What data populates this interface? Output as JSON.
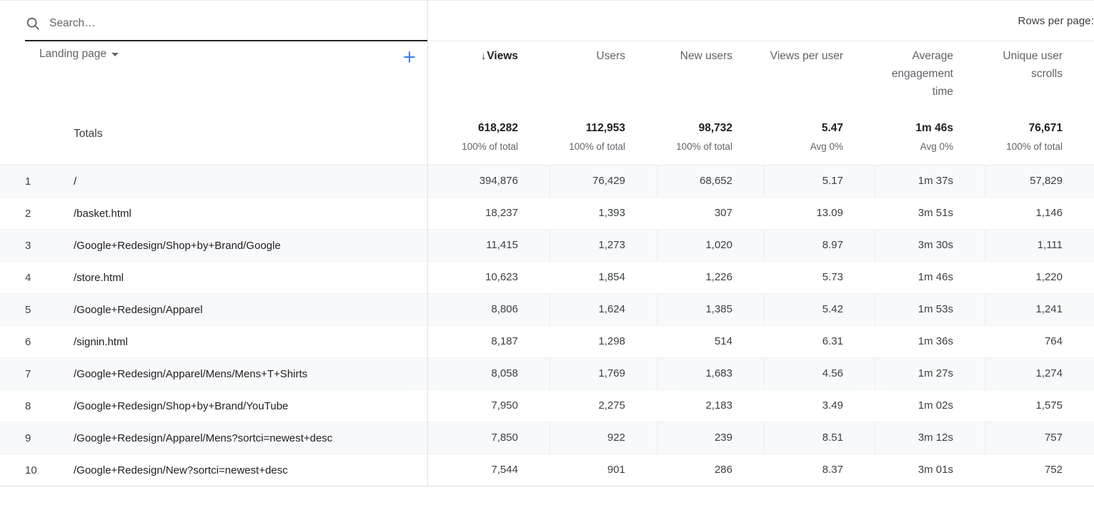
{
  "search": {
    "placeholder": "Search…",
    "value": "",
    "icon": "search-icon"
  },
  "rows_per_page_label": "Rows per page:",
  "dimension": {
    "label": "Landing page",
    "caret_icon": "chevron-down-icon",
    "add_icon": "plus-icon",
    "totals_label": "Totals"
  },
  "colors": {
    "accent_blue": "#4285f4",
    "text_primary": "#202124",
    "text_secondary": "#5f6368",
    "row_shade": "#f8f9fa"
  },
  "chart_data": {
    "type": "table",
    "title": "Landing page",
    "sort": {
      "column": "Views",
      "direction": "descending",
      "indicator": "↓"
    },
    "columns": [
      "Landing page",
      "Views",
      "Users",
      "New users",
      "Views per user",
      "Average engagement time",
      "Unique user scrolls"
    ],
    "totals": {
      "label": "Totals",
      "values": [
        "618,282",
        "112,953",
        "98,732",
        "5.47",
        "1m 46s",
        "76,671"
      ],
      "subvalues": [
        "100% of total",
        "100% of total",
        "100% of total",
        "Avg 0%",
        "Avg 0%",
        "100% of total"
      ]
    },
    "rows": [
      {
        "index": "1",
        "dimension": "/",
        "values": [
          "394,876",
          "76,429",
          "68,652",
          "5.17",
          "1m 37s",
          "57,829"
        ]
      },
      {
        "index": "2",
        "dimension": "/basket.html",
        "values": [
          "18,237",
          "1,393",
          "307",
          "13.09",
          "3m 51s",
          "1,146"
        ]
      },
      {
        "index": "3",
        "dimension": "/Google+Redesign/Shop+by+Brand/Google",
        "values": [
          "11,415",
          "1,273",
          "1,020",
          "8.97",
          "3m 30s",
          "1,111"
        ]
      },
      {
        "index": "4",
        "dimension": "/store.html",
        "values": [
          "10,623",
          "1,854",
          "1,226",
          "5.73",
          "1m 46s",
          "1,220"
        ]
      },
      {
        "index": "5",
        "dimension": "/Google+Redesign/Apparel",
        "values": [
          "8,806",
          "1,624",
          "1,385",
          "5.42",
          "1m 53s",
          "1,241"
        ]
      },
      {
        "index": "6",
        "dimension": "/signin.html",
        "values": [
          "8,187",
          "1,298",
          "514",
          "6.31",
          "1m 36s",
          "764"
        ]
      },
      {
        "index": "7",
        "dimension": "/Google+Redesign/Apparel/Mens/Mens+T+Shirts",
        "values": [
          "8,058",
          "1,769",
          "1,683",
          "4.56",
          "1m 27s",
          "1,274"
        ]
      },
      {
        "index": "8",
        "dimension": "/Google+Redesign/Shop+by+Brand/YouTube",
        "values": [
          "7,950",
          "2,275",
          "2,183",
          "3.49",
          "1m 02s",
          "1,575"
        ]
      },
      {
        "index": "9",
        "dimension": "/Google+Redesign/Apparel/Mens?sortci=newest+desc",
        "values": [
          "7,850",
          "922",
          "239",
          "8.51",
          "3m 12s",
          "757"
        ]
      },
      {
        "index": "10",
        "dimension": "/Google+Redesign/New?sortci=newest+desc",
        "values": [
          "7,544",
          "901",
          "286",
          "8.37",
          "3m 01s",
          "752"
        ]
      }
    ]
  }
}
